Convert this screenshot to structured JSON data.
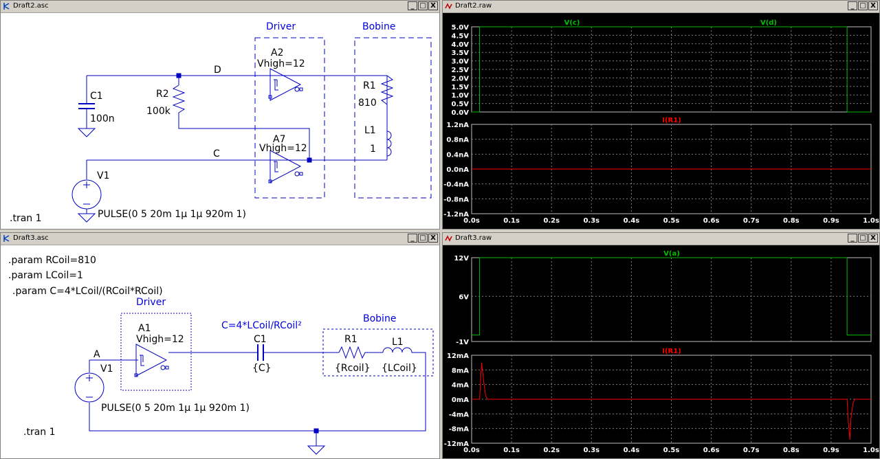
{
  "windows": {
    "draft2_asc": {
      "title": "Draft2.asc"
    },
    "draft2_raw": {
      "title": "Draft2.raw"
    },
    "draft3_asc": {
      "title": "Draft3.asc"
    },
    "draft3_raw": {
      "title": "Draft3.raw"
    }
  },
  "window_buttons": {
    "minimize": "_",
    "maximize": "□",
    "close": "X"
  },
  "schematic2": {
    "driver_label": "Driver",
    "bobine_label": "Bobine",
    "a2_name": "A2",
    "a2_value": "Vhigh=12",
    "a7_name": "A7",
    "a7_value": "Vhigh=12",
    "net_d": "D",
    "net_c": "C",
    "c1_name": "C1",
    "c1_value": "100n",
    "r2_name": "R2",
    "r2_value": "100k",
    "r1_name": "R1",
    "r1_value": "810",
    "l1_name": "L1",
    "l1_value": "1",
    "v1_name": "V1",
    "v1_value": "PULSE(0 5 20m 1µ 1µ 920m 1)",
    "tran": ".tran 1"
  },
  "schematic3": {
    "param1": ".param RCoil=810",
    "param2": ".param LCoil=1",
    "param3": ".param C=4*LCoil/(RCoil*RCoil)",
    "driver_label": "Driver",
    "bobine_label": "Bobine",
    "c_formula": "C=4*LCoil/RCoil²",
    "a1_name": "A1",
    "a1_value": "Vhigh=12",
    "net_a": "A",
    "c1_name": "C1",
    "c1_value": "{C}",
    "r1_name": "R1",
    "r1_value": "{Rcoil}",
    "l1_name": "L1",
    "l1_value": "{LCoil}",
    "v1_name": "V1",
    "v1_value": "PULSE(0 5 20m 1µ 1µ 920m 1)",
    "tran": ".tran 1"
  },
  "colors": {
    "voltage_trace": "#00c000",
    "current_trace": "#ff0000",
    "wire": "#0000c0",
    "label_blue": "#0000e0"
  },
  "chart_data": [
    {
      "type": "line",
      "title": "",
      "series": [
        {
          "name": "V(c)",
          "x": [
            0,
            0.02,
            0.02,
            0.94,
            0.94,
            1.0
          ],
          "y": [
            0,
            0,
            5,
            5,
            0,
            0
          ]
        }
      ],
      "legend": [
        "V(c)",
        "V(d)"
      ],
      "xlim": [
        0,
        1.0
      ],
      "ylim": [
        0,
        5
      ],
      "y_ticks": [
        "5.0V",
        "4.5V",
        "4.0V",
        "3.5V",
        "3.0V",
        "2.5V",
        "2.0V",
        "1.5V",
        "1.0V",
        "0.5V",
        "0.0V"
      ],
      "grid": true
    },
    {
      "type": "line",
      "series": [
        {
          "name": "I(R1)",
          "x": [
            0,
            1.0
          ],
          "y": [
            0,
            0
          ]
        }
      ],
      "xlim": [
        0,
        1.0
      ],
      "ylim": [
        -1.2,
        1.2
      ],
      "y_ticks": [
        "1.2nA",
        "0.8nA",
        "0.4nA",
        "0.0nA",
        "-0.4nA",
        "-0.8nA",
        "-1.2nA"
      ],
      "x_ticks": [
        "0.0s",
        "0.1s",
        "0.2s",
        "0.3s",
        "0.4s",
        "0.5s",
        "0.6s",
        "0.7s",
        "0.8s",
        "0.9s",
        "1.0s"
      ],
      "grid": true
    },
    {
      "type": "line",
      "series": [
        {
          "name": "V(a)",
          "x": [
            0,
            0.02,
            0.02,
            0.94,
            0.94,
            1.0
          ],
          "y": [
            0,
            0,
            12,
            12,
            0,
            0
          ]
        }
      ],
      "xlim": [
        0,
        1.0
      ],
      "ylim": [
        -1,
        12
      ],
      "y_ticks": [
        "12V",
        "6V",
        "-1V"
      ],
      "grid": true
    },
    {
      "type": "line",
      "series": [
        {
          "name": "I(R1)",
          "x": [
            0,
            0.02,
            0.025,
            0.03,
            0.035,
            0.04,
            0.05,
            0.94,
            0.943,
            0.947,
            0.95,
            0.955,
            0.96,
            1.0
          ],
          "y": [
            0,
            0,
            10,
            5,
            1,
            0,
            0,
            0,
            -6,
            -11,
            -5,
            -1,
            0,
            0
          ]
        }
      ],
      "xlim": [
        0,
        1.0
      ],
      "ylim": [
        -12,
        12
      ],
      "y_ticks": [
        "12mA",
        "8mA",
        "4mA",
        "0mA",
        "-4mA",
        "-8mA",
        "-12mA"
      ],
      "x_ticks": [
        "0.0s",
        "0.1s",
        "0.2s",
        "0.3s",
        "0.4s",
        "0.5s",
        "0.6s",
        "0.7s",
        "0.8s",
        "0.9s",
        "1.0s"
      ],
      "grid": true
    }
  ]
}
